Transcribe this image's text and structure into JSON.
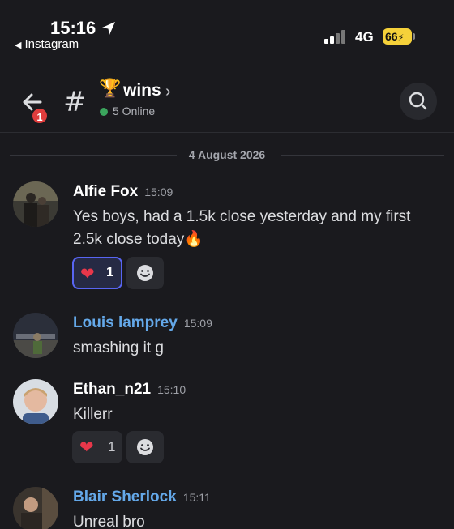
{
  "status": {
    "time": "15:16",
    "back_app": "Instagram",
    "network": "4G",
    "battery": "66"
  },
  "header": {
    "back_badge": "1",
    "channel_emoji": "🏆",
    "channel_name": "wins",
    "online_text": "5 Online"
  },
  "date_divider": "4 August 2026",
  "messages": [
    {
      "author": "Alfie Fox",
      "time": "15:09",
      "text": "Yes boys, had a 1.5k close yesterday and my first 2.5k close today🔥",
      "reaction_count": "1"
    },
    {
      "author": "Louis lamprey",
      "time": "15:09",
      "text": "smashing it g"
    },
    {
      "author": "Ethan_n21",
      "time": "15:10",
      "text": "Killerr",
      "reaction_count": "1"
    },
    {
      "author": "Blair Sherlock",
      "time": "15:11",
      "text": "Unreal bro"
    }
  ],
  "colors": {
    "background": "#1a1a1e",
    "accent": "#5865f2",
    "online": "#3ba55d",
    "badge": "#e03d3d",
    "author_blue": "#64a8e9"
  }
}
